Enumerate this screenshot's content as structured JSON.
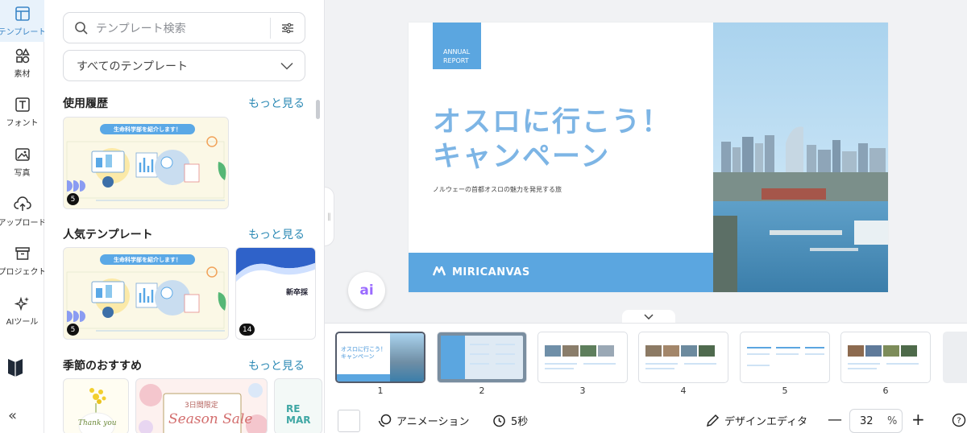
{
  "rail": {
    "items": [
      {
        "label": "テンプレート",
        "icon": "template-icon",
        "active": true
      },
      {
        "label": "素材",
        "icon": "elements-icon"
      },
      {
        "label": "フォント",
        "icon": "text-icon"
      },
      {
        "label": "写真",
        "icon": "photo-icon"
      },
      {
        "label": "アップロード",
        "icon": "upload-icon"
      },
      {
        "label": "プロジェクト",
        "icon": "project-icon"
      },
      {
        "label": "AIツール",
        "icon": "ai-tools-icon"
      }
    ]
  },
  "panel": {
    "search_placeholder": "テンプレート検索",
    "category_select": "すべてのテンプレート",
    "sections": [
      {
        "title": "使用履歴",
        "more": "もっと見る"
      },
      {
        "title": "人気テンプレート",
        "more": "もっと見る"
      },
      {
        "title": "季節のおすすめ",
        "more": "もっと見る"
      }
    ],
    "recent_thumb": {
      "banner": "生命科学部を紹介します！",
      "badge": "5"
    },
    "popular_thumbs": [
      {
        "banner": "生命科学部を紹介します！",
        "badge": "5"
      },
      {
        "title": "新卒採",
        "badge": "14"
      }
    ],
    "seasonal_thumbs": [
      {
        "text": "Thank you"
      },
      {
        "top": "3日間限定",
        "text": "Season Sale"
      },
      {
        "text": "RE MAR"
      }
    ]
  },
  "slide": {
    "tag_line1": "ANNUAL",
    "tag_line2": "REPORT",
    "title_line1": "オスロに行こう！",
    "title_line2": "キャンペーン",
    "subtitle": "ノルウェーの首都オスロの魅力を発見する旅",
    "brand": "MIRICANVAS"
  },
  "ai_button": "ai",
  "pages": [
    {
      "num": "1",
      "active": true
    },
    {
      "num": "2"
    },
    {
      "num": "3"
    },
    {
      "num": "4"
    },
    {
      "num": "5"
    },
    {
      "num": "6"
    }
  ],
  "toolbar": {
    "animation": "アニメーション",
    "duration": "5秒",
    "design_editor": "デザインエディタ",
    "zoom": "32",
    "zoom_unit": "%"
  },
  "colors": {
    "accent": "#5ba6e0",
    "link": "#2d8ab5",
    "title": "#7db5e5"
  }
}
